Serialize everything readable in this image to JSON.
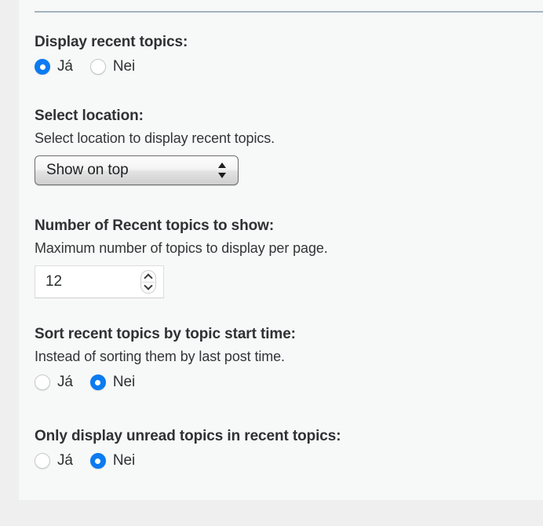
{
  "panel": {
    "background_color": "#f7f8f8",
    "page_background_color": "#efefef",
    "divider_color": "#a4b2bf",
    "accent_color": "#0b7bf1"
  },
  "fields": [
    {
      "title": "Display recent topics:",
      "description": "",
      "control": "radio",
      "options": [
        {
          "label": "Já",
          "selected": true
        },
        {
          "label": "Nei",
          "selected": false
        }
      ]
    },
    {
      "title": "Select location:",
      "description": "Select location to display recent topics.",
      "control": "select",
      "value": "Show on top"
    },
    {
      "title": "Number of Recent topics to show:",
      "description": "Maximum number of topics to display per page.",
      "control": "number",
      "value": "12"
    },
    {
      "title": "Sort recent topics by topic start time:",
      "description": "Instead of sorting them by last post time.",
      "control": "radio",
      "options": [
        {
          "label": "Já",
          "selected": false
        },
        {
          "label": "Nei",
          "selected": true
        }
      ]
    },
    {
      "title": "Only display unread topics in recent topics:",
      "description": "",
      "control": "radio",
      "options": [
        {
          "label": "Já",
          "selected": false
        },
        {
          "label": "Nei",
          "selected": true
        }
      ]
    }
  ]
}
